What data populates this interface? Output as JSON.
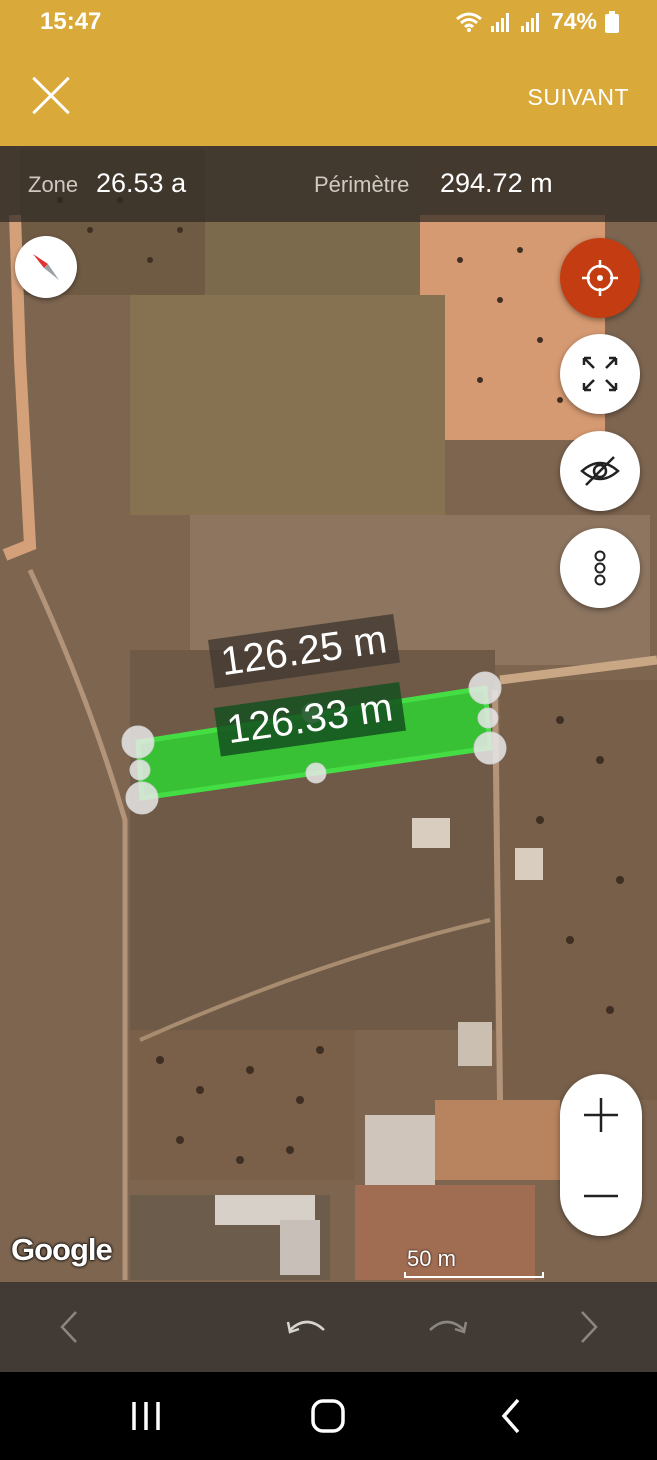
{
  "status_bar": {
    "time": "15:47",
    "battery": "74%"
  },
  "app_bar": {
    "close_icon": "close-icon",
    "next_label": "SUIVANT",
    "color": "#d9a93a"
  },
  "measure": {
    "area_label": "Zone",
    "area_value": "26.53 a",
    "perimeter_label": "Périmètre",
    "perimeter_value": "294.72 m"
  },
  "map": {
    "distance_top": "126.25 m",
    "distance_bottom": "126.33 m",
    "polygon_color": "#33cc33",
    "scale_label": "50 m",
    "attribution": "Google"
  },
  "controls": {
    "compass": "compass-icon",
    "locate": "target-icon",
    "fit": "expand-icon",
    "visibility": "eye-off-icon",
    "more": "more-vert-icon",
    "zoom_in": "plus-icon",
    "zoom_out": "minus-icon",
    "locate_color": "#c43d12"
  },
  "toolbar": {
    "prev": "chevron-left-icon",
    "undo": "undo-icon",
    "redo": "redo-icon",
    "next": "chevron-right-icon"
  },
  "nav": {
    "recents": "recents-icon",
    "home": "home-icon",
    "back": "back-icon"
  }
}
